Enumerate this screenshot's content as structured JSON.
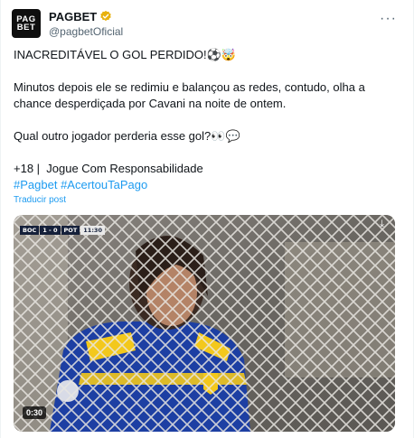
{
  "account": {
    "avatar_line1": "PAG",
    "avatar_line2": "BET",
    "display_name": "PAGBET",
    "handle": "@pagbetOficial",
    "verified_color": "#e8b10d"
  },
  "tweet": {
    "line1": "INACREDITÁVEL O GOL PERDIDO!⚽🤯",
    "line2": "Minutos depois ele se redimiu e balançou as redes, contudo, olha a chance desperdiçada por Cavani na noite de ontem.",
    "line3": "Qual outro jogador perderia esse gol?👀💬",
    "line4": "+18 |  Jogue Com Responsabilidade",
    "hashtags": [
      "#Pagbet",
      "#AcertouTaPago"
    ],
    "translate_label": "Traducir post"
  },
  "video": {
    "duration": "0:30",
    "score": {
      "home": "BOC",
      "score": "1 - 0",
      "away": "POT",
      "clock": "11:30"
    }
  },
  "colors": {
    "link": "#1d9bf0",
    "muted": "#536471"
  }
}
